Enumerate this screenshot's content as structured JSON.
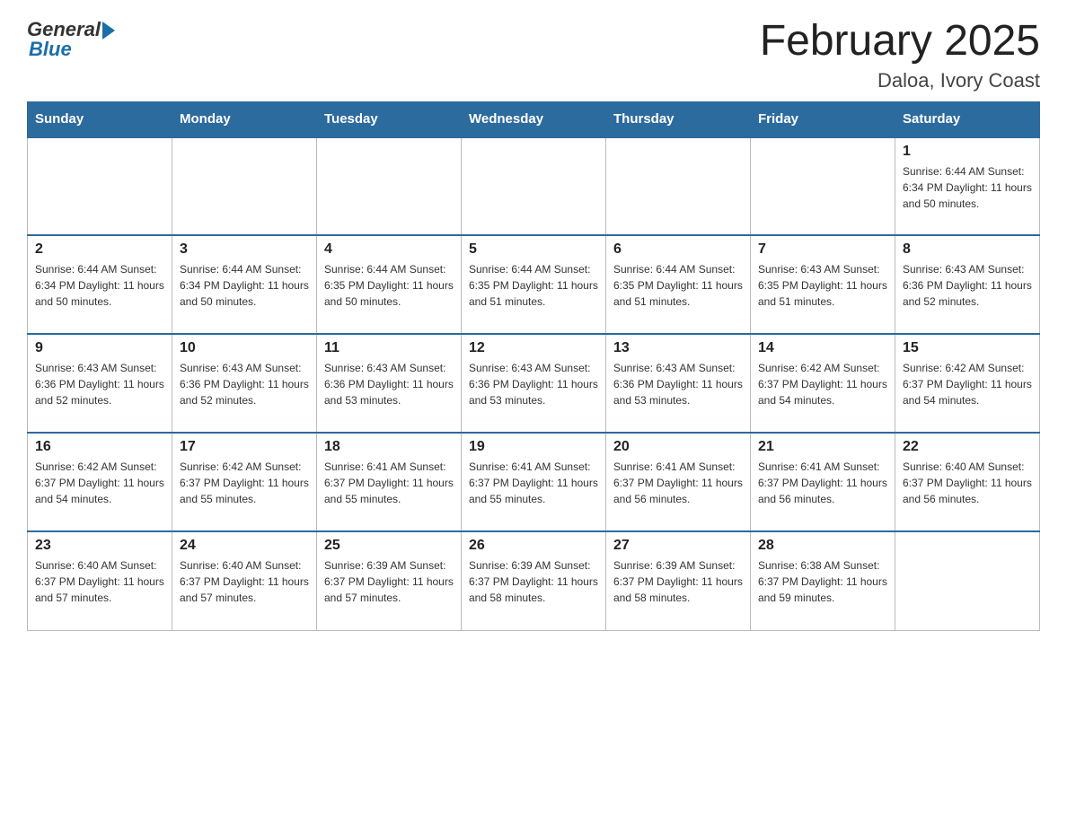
{
  "header": {
    "logo_general": "General",
    "logo_blue": "Blue",
    "title": "February 2025",
    "location": "Daloa, Ivory Coast"
  },
  "weekdays": [
    "Sunday",
    "Monday",
    "Tuesday",
    "Wednesday",
    "Thursday",
    "Friday",
    "Saturday"
  ],
  "weeks": [
    [
      {
        "day": "",
        "info": ""
      },
      {
        "day": "",
        "info": ""
      },
      {
        "day": "",
        "info": ""
      },
      {
        "day": "",
        "info": ""
      },
      {
        "day": "",
        "info": ""
      },
      {
        "day": "",
        "info": ""
      },
      {
        "day": "1",
        "info": "Sunrise: 6:44 AM\nSunset: 6:34 PM\nDaylight: 11 hours\nand 50 minutes."
      }
    ],
    [
      {
        "day": "2",
        "info": "Sunrise: 6:44 AM\nSunset: 6:34 PM\nDaylight: 11 hours\nand 50 minutes."
      },
      {
        "day": "3",
        "info": "Sunrise: 6:44 AM\nSunset: 6:34 PM\nDaylight: 11 hours\nand 50 minutes."
      },
      {
        "day": "4",
        "info": "Sunrise: 6:44 AM\nSunset: 6:35 PM\nDaylight: 11 hours\nand 50 minutes."
      },
      {
        "day": "5",
        "info": "Sunrise: 6:44 AM\nSunset: 6:35 PM\nDaylight: 11 hours\nand 51 minutes."
      },
      {
        "day": "6",
        "info": "Sunrise: 6:44 AM\nSunset: 6:35 PM\nDaylight: 11 hours\nand 51 minutes."
      },
      {
        "day": "7",
        "info": "Sunrise: 6:43 AM\nSunset: 6:35 PM\nDaylight: 11 hours\nand 51 minutes."
      },
      {
        "day": "8",
        "info": "Sunrise: 6:43 AM\nSunset: 6:36 PM\nDaylight: 11 hours\nand 52 minutes."
      }
    ],
    [
      {
        "day": "9",
        "info": "Sunrise: 6:43 AM\nSunset: 6:36 PM\nDaylight: 11 hours\nand 52 minutes."
      },
      {
        "day": "10",
        "info": "Sunrise: 6:43 AM\nSunset: 6:36 PM\nDaylight: 11 hours\nand 52 minutes."
      },
      {
        "day": "11",
        "info": "Sunrise: 6:43 AM\nSunset: 6:36 PM\nDaylight: 11 hours\nand 53 minutes."
      },
      {
        "day": "12",
        "info": "Sunrise: 6:43 AM\nSunset: 6:36 PM\nDaylight: 11 hours\nand 53 minutes."
      },
      {
        "day": "13",
        "info": "Sunrise: 6:43 AM\nSunset: 6:36 PM\nDaylight: 11 hours\nand 53 minutes."
      },
      {
        "day": "14",
        "info": "Sunrise: 6:42 AM\nSunset: 6:37 PM\nDaylight: 11 hours\nand 54 minutes."
      },
      {
        "day": "15",
        "info": "Sunrise: 6:42 AM\nSunset: 6:37 PM\nDaylight: 11 hours\nand 54 minutes."
      }
    ],
    [
      {
        "day": "16",
        "info": "Sunrise: 6:42 AM\nSunset: 6:37 PM\nDaylight: 11 hours\nand 54 minutes."
      },
      {
        "day": "17",
        "info": "Sunrise: 6:42 AM\nSunset: 6:37 PM\nDaylight: 11 hours\nand 55 minutes."
      },
      {
        "day": "18",
        "info": "Sunrise: 6:41 AM\nSunset: 6:37 PM\nDaylight: 11 hours\nand 55 minutes."
      },
      {
        "day": "19",
        "info": "Sunrise: 6:41 AM\nSunset: 6:37 PM\nDaylight: 11 hours\nand 55 minutes."
      },
      {
        "day": "20",
        "info": "Sunrise: 6:41 AM\nSunset: 6:37 PM\nDaylight: 11 hours\nand 56 minutes."
      },
      {
        "day": "21",
        "info": "Sunrise: 6:41 AM\nSunset: 6:37 PM\nDaylight: 11 hours\nand 56 minutes."
      },
      {
        "day": "22",
        "info": "Sunrise: 6:40 AM\nSunset: 6:37 PM\nDaylight: 11 hours\nand 56 minutes."
      }
    ],
    [
      {
        "day": "23",
        "info": "Sunrise: 6:40 AM\nSunset: 6:37 PM\nDaylight: 11 hours\nand 57 minutes."
      },
      {
        "day": "24",
        "info": "Sunrise: 6:40 AM\nSunset: 6:37 PM\nDaylight: 11 hours\nand 57 minutes."
      },
      {
        "day": "25",
        "info": "Sunrise: 6:39 AM\nSunset: 6:37 PM\nDaylight: 11 hours\nand 57 minutes."
      },
      {
        "day": "26",
        "info": "Sunrise: 6:39 AM\nSunset: 6:37 PM\nDaylight: 11 hours\nand 58 minutes."
      },
      {
        "day": "27",
        "info": "Sunrise: 6:39 AM\nSunset: 6:37 PM\nDaylight: 11 hours\nand 58 minutes."
      },
      {
        "day": "28",
        "info": "Sunrise: 6:38 AM\nSunset: 6:37 PM\nDaylight: 11 hours\nand 59 minutes."
      },
      {
        "day": "",
        "info": ""
      }
    ]
  ]
}
